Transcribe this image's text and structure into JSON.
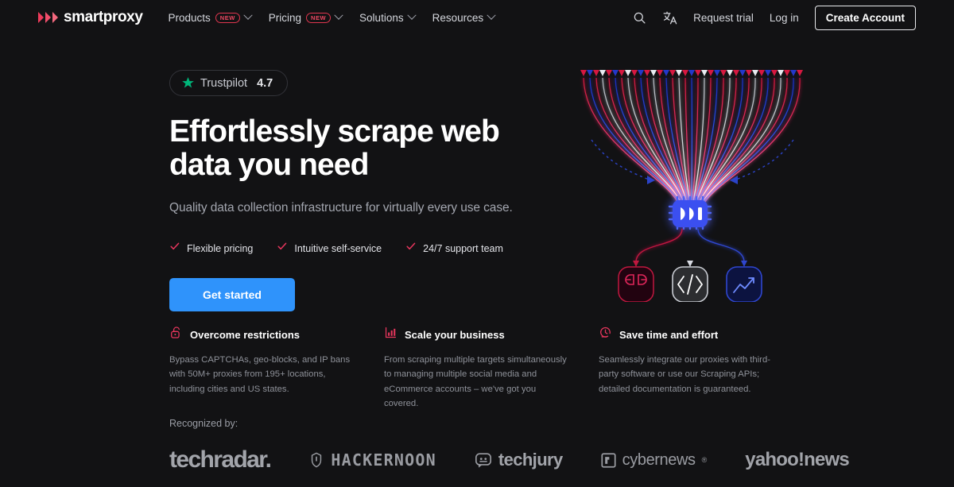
{
  "brand": {
    "name": "smartproxy",
    "logo_icon": "smartproxy-triple-play-mark",
    "accent_pink": "#ED3B5B",
    "accent_blue": "#2F93FB",
    "background": "#121214"
  },
  "nav": {
    "items": [
      {
        "label": "Products",
        "badge": "NEW",
        "has_dropdown": true
      },
      {
        "label": "Pricing",
        "badge": "NEW",
        "has_dropdown": true
      },
      {
        "label": "Solutions",
        "badge": null,
        "has_dropdown": true
      },
      {
        "label": "Resources",
        "badge": null,
        "has_dropdown": true
      }
    ],
    "search_icon": "search-icon",
    "language_icon": "translate-icon",
    "request_trial": "Request trial",
    "log_in": "Log in",
    "create_account": "Create Account"
  },
  "hero": {
    "trustpilot": {
      "star_icon": "trustpilot-star-icon",
      "star_color": "#00B67A",
      "name": "Trustpilot",
      "score": "4.7"
    },
    "headline": "Effortlessly scrape web data you need",
    "subheadline": "Quality data collection infrastructure for virtually every use case.",
    "checks": [
      {
        "icon": "check-icon",
        "label": "Flexible pricing"
      },
      {
        "icon": "check-icon",
        "label": "Intuitive self-service"
      },
      {
        "icon": "check-icon",
        "label": "24/7 support team"
      }
    ],
    "cta_label": "Get started"
  },
  "features": [
    {
      "icon": "unlock-icon",
      "title": "Overcome restrictions",
      "body": "Bypass CAPTCHAs, geo-blocks, and IP bans with 50M+ proxies from 195+ locations, including cities and US states."
    },
    {
      "icon": "bar-chart-growth-icon",
      "title": "Scale your business",
      "body": "From scraping multiple targets simultaneously to managing multiple social media and eCommerce accounts – we've got you covered."
    },
    {
      "icon": "clock-speed-icon",
      "title": "Save time and effort",
      "body": "Seamlessly integrate our proxies with third-party software or use our Scraping APIs; detailed documentation is guaranteed."
    }
  ],
  "recognized": {
    "label": "Recognized by:",
    "logos": [
      {
        "name": "techradar.",
        "icon": "techradar-logo"
      },
      {
        "name": "HACKERNOON",
        "icon": "hackernoon-logo"
      },
      {
        "name": "techjury",
        "icon": "techjury-logo"
      },
      {
        "name": "cybernews",
        "icon": "cybernews-logo",
        "mark": "®"
      },
      {
        "name": "yahoo!news",
        "icon": "yahoo-news-logo"
      }
    ]
  },
  "graphic": {
    "chip_icon": "smartproxy-chip-icon",
    "nodes": [
      {
        "icon": "proxy-connector-icon",
        "color": "#C0183F"
      },
      {
        "icon": "code-brackets-icon",
        "color": "#C8CBD2"
      },
      {
        "icon": "analytics-trend-icon",
        "color": "#2F46CF"
      }
    ]
  }
}
